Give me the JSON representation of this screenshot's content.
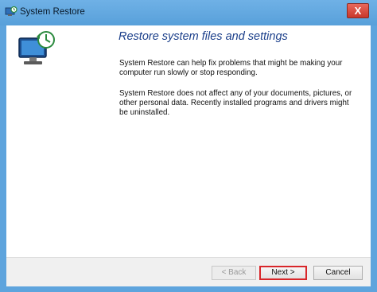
{
  "window": {
    "title": "System Restore",
    "close_label": "X"
  },
  "content": {
    "heading": "Restore system files and settings",
    "paragraph1": "System Restore can help fix problems that might be making your computer run slowly or stop responding.",
    "paragraph2": "System Restore does not affect any of your documents, pictures, or other personal data. Recently installed programs and drivers might be uninstalled."
  },
  "buttons": {
    "back": "< Back",
    "next": "Next >",
    "cancel": "Cancel"
  },
  "colors": {
    "title_bar": "#5ea4dd",
    "heading": "#1a3e8a",
    "close": "#c8372b",
    "highlight": "#d8262a"
  },
  "icons": {
    "title": "system-restore-icon",
    "side": "computer-restore-icon"
  }
}
